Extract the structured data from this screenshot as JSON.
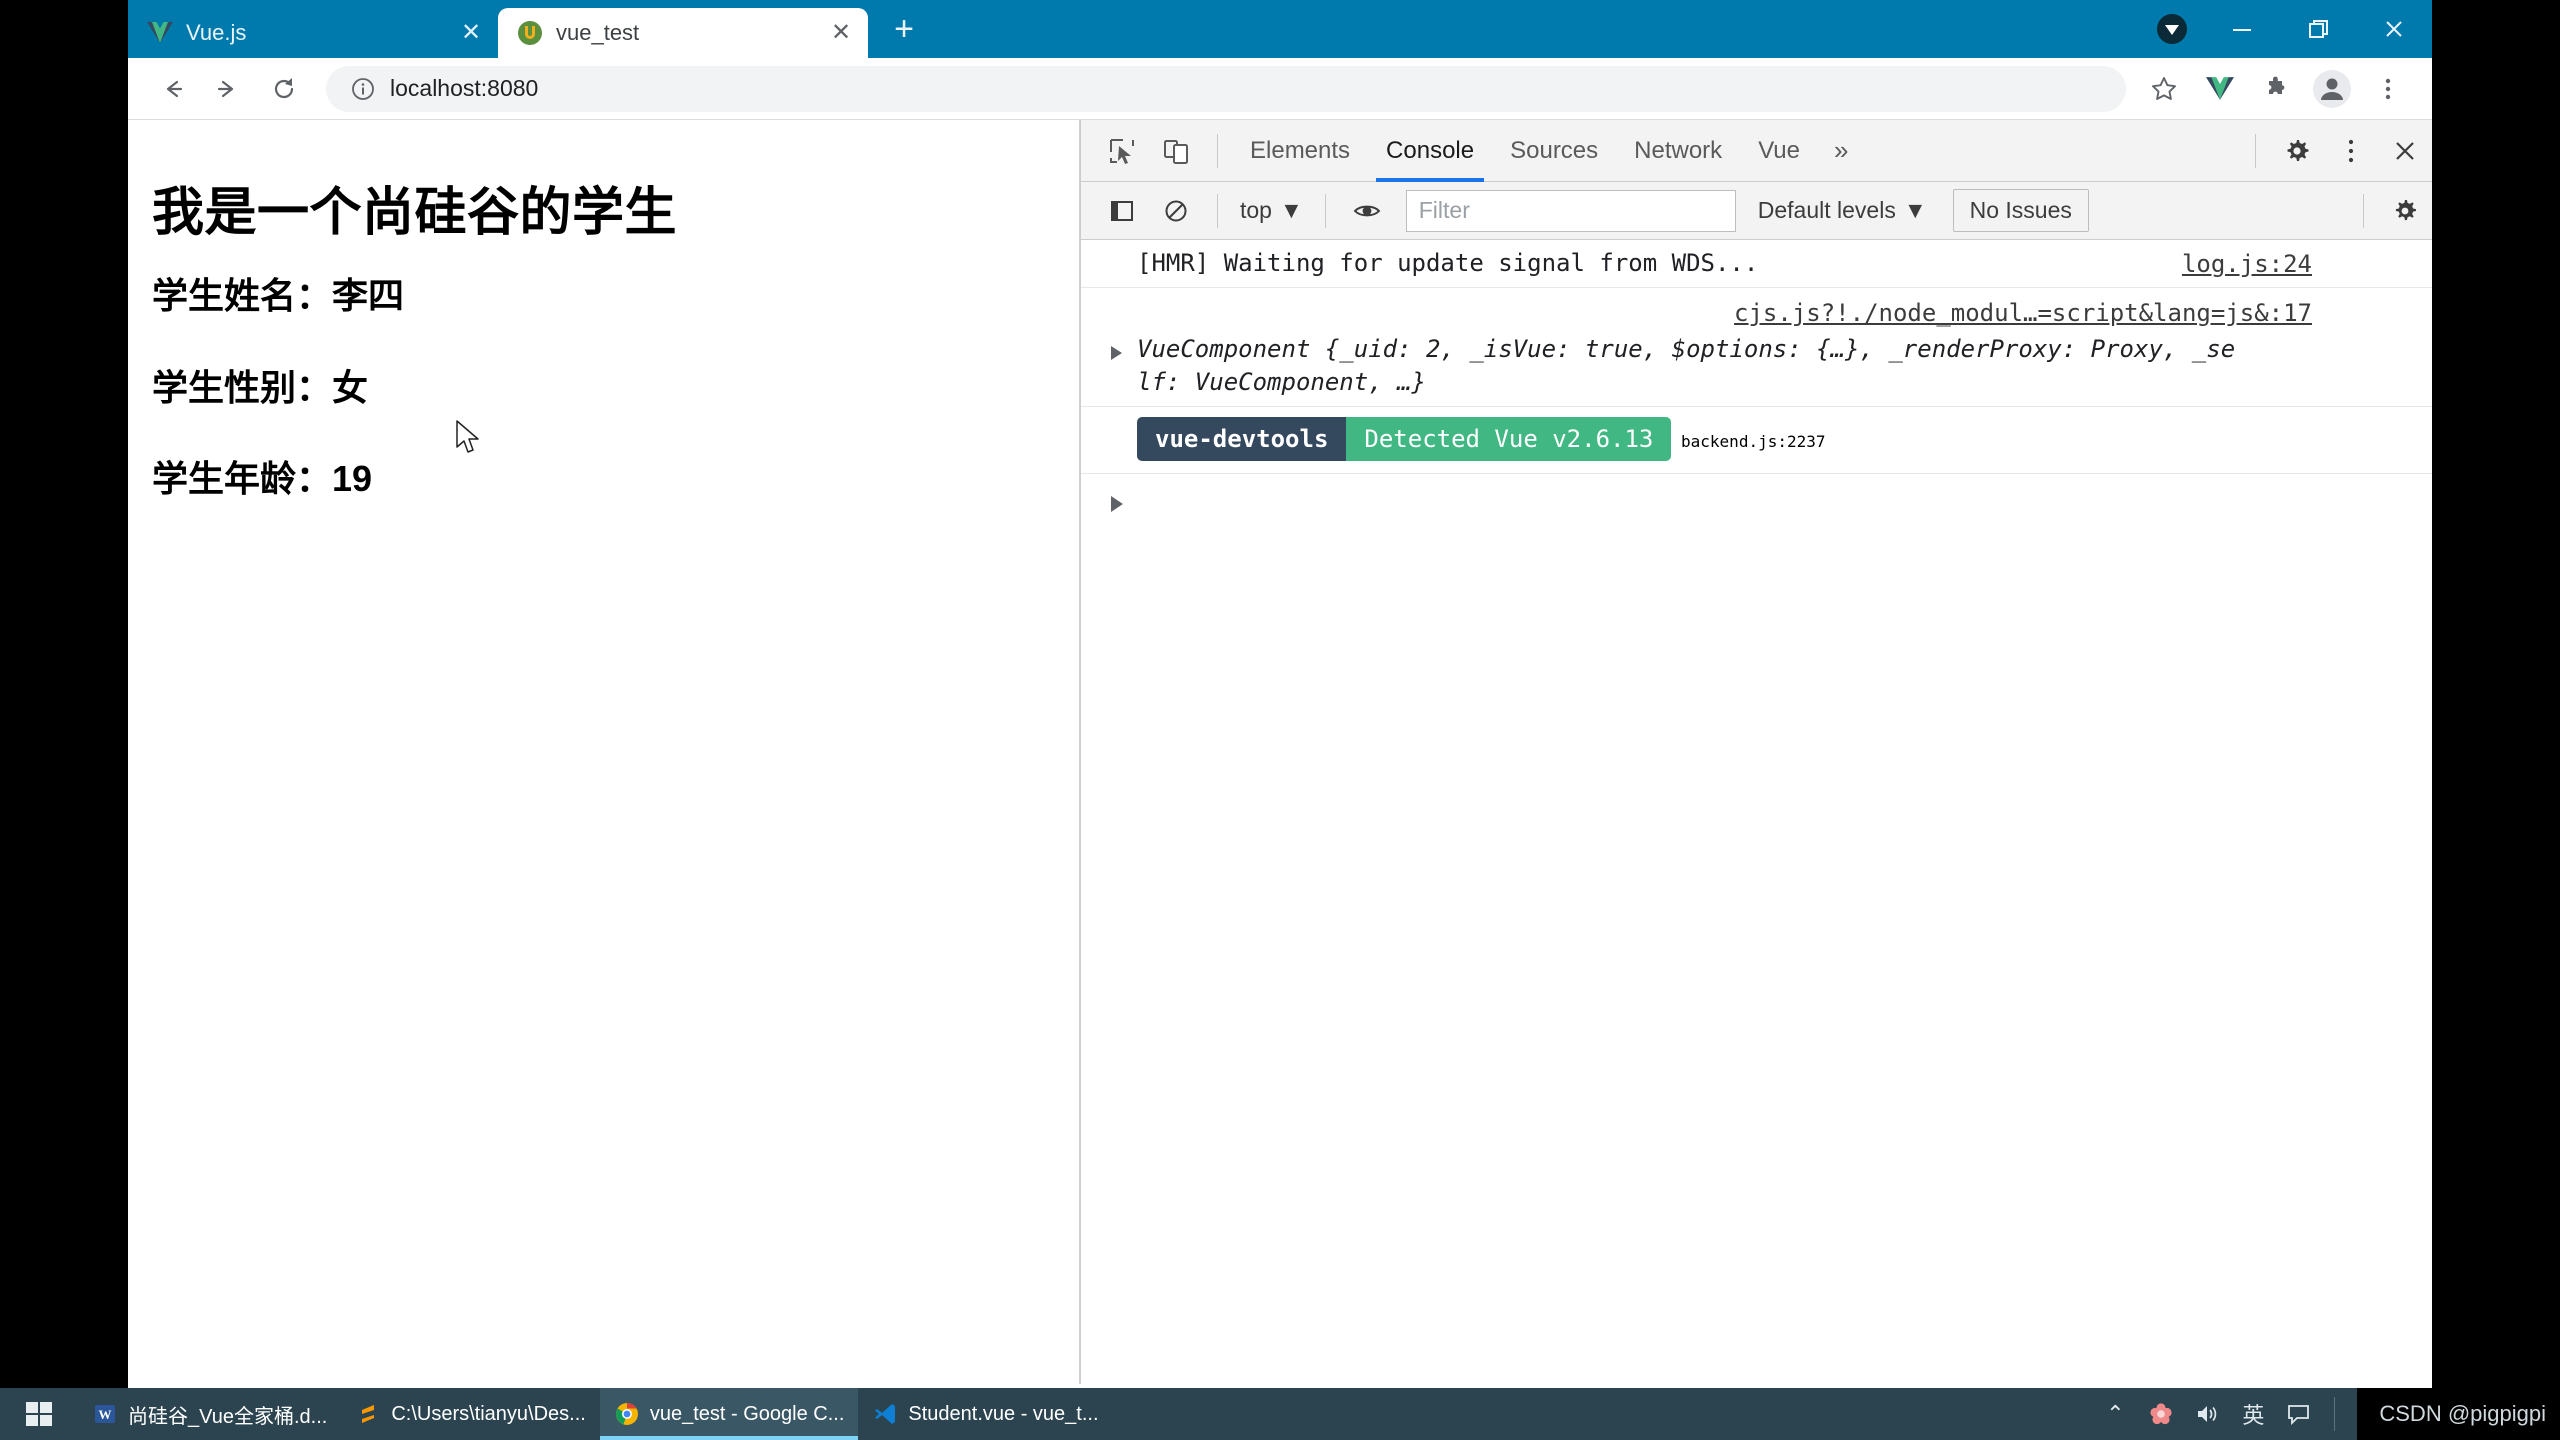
{
  "browser": {
    "tabs": [
      {
        "title": "Vue.js",
        "favicon": "vue-logo-icon",
        "active": false
      },
      {
        "title": "vue_test",
        "favicon": "vue-test-icon",
        "active": true
      }
    ],
    "new_tab_label": "+",
    "window_controls": {
      "download": "download-icon",
      "minimize": "–",
      "restore": "restore-icon",
      "close": "✕"
    },
    "nav": {
      "back": "back-arrow-icon",
      "forward": "forward-arrow-icon",
      "reload": "reload-icon"
    },
    "omnibox": {
      "info_icon": "info-circle-icon",
      "url": "localhost:8080",
      "host": "localhost",
      "port": ":8080"
    },
    "toolbar_icons": [
      "bookmark-star-icon",
      "vue-devtools-icon",
      "extensions-puzzle-icon",
      "profile-avatar-icon",
      "chrome-menu-icon"
    ],
    "accent_color": "#0079ad"
  },
  "page": {
    "heading": "我是一个尚硅谷的学生",
    "fields": [
      {
        "label": "学生姓名：",
        "value": "李四"
      },
      {
        "label": "学生性别：",
        "value": "女"
      },
      {
        "label": "学生年龄：",
        "value": "19"
      }
    ]
  },
  "devtools": {
    "left_icons": [
      "inspect-element-icon",
      "device-toolbar-icon"
    ],
    "tabs": [
      {
        "label": "Elements",
        "active": false
      },
      {
        "label": "Console",
        "active": true
      },
      {
        "label": "Sources",
        "active": false
      },
      {
        "label": "Network",
        "active": false
      },
      {
        "label": "Vue",
        "active": false
      }
    ],
    "overflow_label": "»",
    "right_icons": [
      "settings-gear-icon",
      "devtools-menu-icon",
      "close-devtools-icon"
    ],
    "console_toolbar": {
      "sidebar_toggle": "console-sidebar-icon",
      "clear": "clear-console-icon",
      "context": "top",
      "context_caret": "▼",
      "eye": "live-expression-eye-icon",
      "filter_placeholder": "Filter",
      "filter_value": "",
      "levels": "Default levels",
      "levels_caret": "▼",
      "issues": "No Issues",
      "settings": "console-settings-gear-icon"
    },
    "messages": [
      {
        "kind": "text",
        "text": "[HMR] Waiting for update signal from WDS...",
        "source": "log.js:24"
      },
      {
        "kind": "object",
        "source": "cjs.js?!./node_modul…=script&lang=js&:17",
        "prefix": "VueComponent {",
        "parts": "_uid: 2, _isVue: true, $options: {…}, _renderProxy: Proxy, _self: VueComponent, …}",
        "line1": "VueComponent {_uid: 2, _isVue: true, $options: {…}, _renderProxy: Proxy, _se",
        "line2": "lf: VueComponent, …}"
      },
      {
        "kind": "badge",
        "badge_left": "vue-devtools",
        "badge_right": "Detected Vue v2.6.13",
        "source": "backend.js:2237",
        "color_left": "#35495e",
        "color_right": "#41b883"
      }
    ]
  },
  "taskbar": {
    "start_label": "windows-start-icon",
    "items": [
      {
        "label": "尚硅谷_Vue全家桶.d...",
        "icon": "word-icon",
        "active": false
      },
      {
        "label": "C:\\Users\\tianyu\\Des...",
        "icon": "sublime-icon",
        "active": false
      },
      {
        "label": "vue_test - Google C...",
        "icon": "chrome-icon",
        "active": true
      },
      {
        "label": "Student.vue - vue_t...",
        "icon": "vscode-icon",
        "active": false
      }
    ],
    "tray": [
      {
        "name": "show-hidden-icons-chevron",
        "glyph": "⌃"
      },
      {
        "name": "antivirus-flower-icon",
        "glyph": "✿"
      },
      {
        "name": "volume-speaker-icon",
        "glyph": "🔊"
      },
      {
        "name": "ime-language-indicator",
        "glyph": "英"
      },
      {
        "name": "action-center-icon",
        "glyph": "🗨"
      }
    ],
    "watermark": "CSDN @pigpigpi"
  }
}
